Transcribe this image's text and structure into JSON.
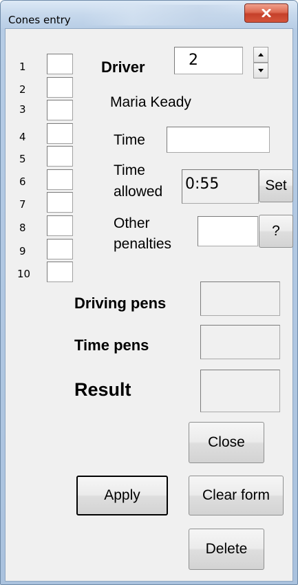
{
  "window": {
    "title": "Cones entry",
    "close_icon": "close-icon"
  },
  "cones": {
    "labels": [
      "1",
      "2",
      "3",
      "4",
      "5",
      "6",
      "7",
      "8",
      "9",
      "10"
    ],
    "values": [
      "",
      "",
      "",
      "",
      "",
      "",
      "",
      "",
      "",
      ""
    ]
  },
  "driver": {
    "label": "Driver",
    "value": "2",
    "name": "Maria Keady"
  },
  "time": {
    "label": "Time",
    "value": ""
  },
  "time_allowed": {
    "label_line1": "Time",
    "label_line2": "allowed",
    "value": "0:55",
    "set_label": "Set"
  },
  "other_penalties": {
    "label_line1": "Other",
    "label_line2": "penalties",
    "value": "",
    "help_label": "?"
  },
  "driving_pens": {
    "label": "Driving pens",
    "value": ""
  },
  "time_pens": {
    "label": "Time pens",
    "value": ""
  },
  "result": {
    "label": "Result",
    "value": ""
  },
  "buttons": {
    "close": "Close",
    "apply": "Apply",
    "clear": "Clear form",
    "delete": "Delete"
  }
}
